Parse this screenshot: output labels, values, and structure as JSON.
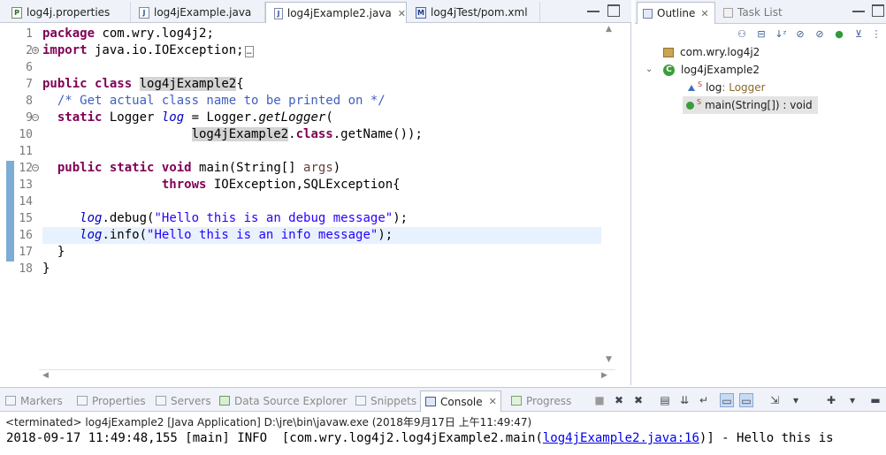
{
  "editor_tabs": [
    {
      "label": "log4j.properties",
      "icon": "properties-file-icon",
      "active": false
    },
    {
      "label": "log4jExample.java",
      "icon": "java-file-icon",
      "active": false
    },
    {
      "label": "log4jExample2.java",
      "icon": "java-file-icon",
      "active": true
    },
    {
      "label": "log4jTest/pom.xml",
      "icon": "maven-pom-icon",
      "active": false
    }
  ],
  "editor": {
    "line_numbers": [
      "1",
      "2",
      "6",
      "7",
      "8",
      "9",
      "10",
      "11",
      "12",
      "13",
      "14",
      "15",
      "16",
      "17",
      "18"
    ],
    "collapsed_marker": "…",
    "line1": {
      "kw": "package",
      "rest": " com.wry.log4j2;"
    },
    "line2": {
      "kw": "import",
      "rest": " java.io.IOException;"
    },
    "line7": {
      "kw1": "public",
      "kw2": "class",
      "name": "log4jExample2",
      "brace": "{"
    },
    "line8": {
      "comment": "/* Get actual class name to be printed on */"
    },
    "line9": {
      "kw": "static",
      "type": " Logger ",
      "field": "log",
      "eq": " = Logger.",
      "method": "getLogger",
      "paren": "("
    },
    "line10": {
      "name": "log4jExample2",
      "dot": ".",
      "kw": "class",
      "rest": ".getName());"
    },
    "line12": {
      "kw1": "public",
      "kw2": "static",
      "kw3": "void",
      "rest": " main(String[] ",
      "param": "args",
      "close": ")"
    },
    "line13": {
      "kw": "throws",
      "rest": " IOException,SQLException{"
    },
    "line15": {
      "field": "log",
      "call": ".debug(",
      "str": "\"Hello this is an debug message\"",
      "end": ");"
    },
    "line16": {
      "field": "log",
      "call": ".info(",
      "str": "\"Hello this is an info message\"",
      "end": ");"
    },
    "line17": {
      "text": "}"
    },
    "line18": {
      "text": "}"
    }
  },
  "outline": {
    "tabs": [
      {
        "label": "Outline",
        "active": true
      },
      {
        "label": "Task List",
        "active": false
      }
    ],
    "nodes": {
      "package": "com.wry.log4j2",
      "class": "log4jExample2",
      "field_name": "log",
      "field_type": " : Logger",
      "static_marker": "S",
      "method": "main(String[]) : void"
    }
  },
  "console": {
    "tabs": [
      {
        "label": "Markers",
        "active": false
      },
      {
        "label": "Properties",
        "active": false
      },
      {
        "label": "Servers",
        "active": false
      },
      {
        "label": "Data Source Explorer",
        "active": false
      },
      {
        "label": "Snippets",
        "active": false
      },
      {
        "label": "Console",
        "active": true
      },
      {
        "label": "Progress",
        "active": false
      }
    ],
    "terminated": "<terminated> log4jExample2 [Java Application] D:\\jre\\bin\\javaw.exe (2018年9月17日 上午11:49:47)",
    "output_prefix": "2018-09-17 11:49:48,155 [main] INFO  [com.wry.log4j2.log4jExample2.main(",
    "output_link": "log4jExample2.java:16",
    "output_suffix": ")] - Hello this is"
  },
  "colors": {
    "keyword": "#7f0055",
    "comment": "#3f5fbf",
    "string": "#2a00ff",
    "field": "#0000c0",
    "current_line": "#e8f2fe"
  }
}
